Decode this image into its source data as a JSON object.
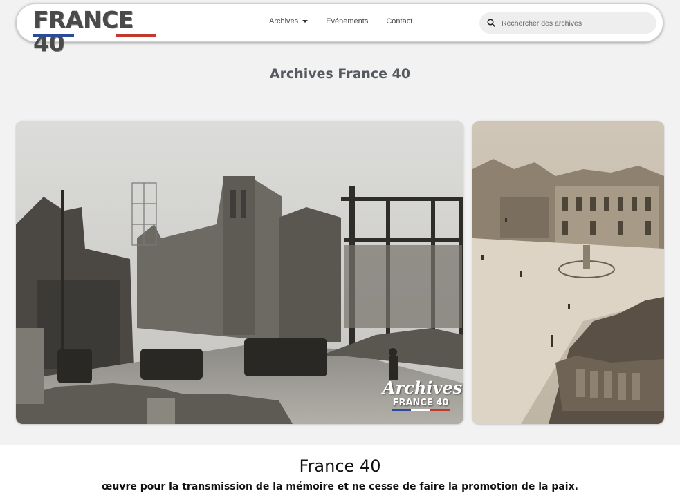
{
  "header": {
    "logo_text": "FRANCE 40",
    "nav": [
      {
        "label": "Archives",
        "has_dropdown": true
      },
      {
        "label": "Evénements"
      },
      {
        "label": "Contact"
      }
    ],
    "search": {
      "placeholder": "Rechercher des archives",
      "value": ""
    }
  },
  "colors": {
    "blue": "#2c4a9a",
    "white": "#ffffff",
    "red": "#c0392b",
    "rule": "#c0392b"
  },
  "page": {
    "title": "Archives France 40"
  },
  "gallery": {
    "main_image": {
      "watermark": {
        "script": "Archives",
        "brand": "FRANCE 40"
      }
    },
    "side_image": {}
  },
  "about": {
    "heading": "France 40",
    "tagline": "œuvre pour la transmission de la mémoire et ne cesse de faire la promotion de la paix."
  }
}
